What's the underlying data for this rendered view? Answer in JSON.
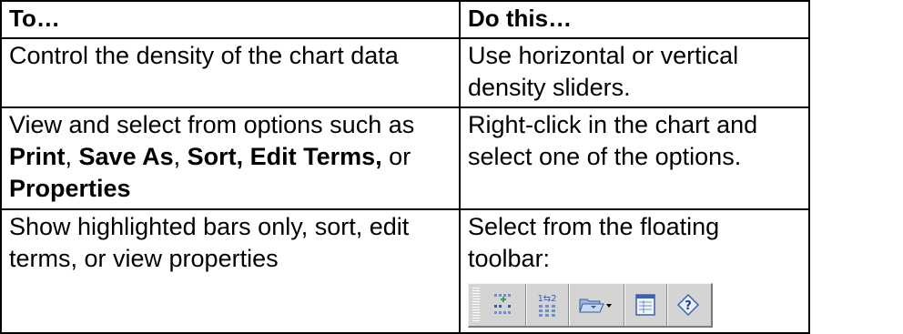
{
  "table": {
    "headers": [
      "To…",
      "Do this…"
    ],
    "rows": [
      {
        "to": "Control the density of the chart data",
        "do": "Use horizontal or vertical density sliders."
      },
      {
        "to_parts": [
          {
            "text": "View and select from options such as ",
            "bold": false
          },
          {
            "text": "Print",
            "bold": true
          },
          {
            "text": ", ",
            "bold": false
          },
          {
            "text": "Save As",
            "bold": true
          },
          {
            "text": ", ",
            "bold": false
          },
          {
            "text": "Sort, Edit Terms,",
            "bold": true
          },
          {
            "text": " or ",
            "bold": false
          },
          {
            "text": "Properties",
            "bold": true
          }
        ],
        "do": "Right-click in the chart and select one of the options."
      },
      {
        "to": "Show highlighted bars only, sort, edit terms, or view properties",
        "do": "Select from the floating toolbar:"
      }
    ]
  },
  "toolbar": {
    "buttons": [
      {
        "icon": "highlighted-bars-icon"
      },
      {
        "icon": "sort-icon",
        "text": "1⇆2"
      },
      {
        "icon": "edit-terms-folder-icon"
      },
      {
        "icon": "properties-icon"
      },
      {
        "icon": "help-icon",
        "text": "?"
      }
    ]
  }
}
